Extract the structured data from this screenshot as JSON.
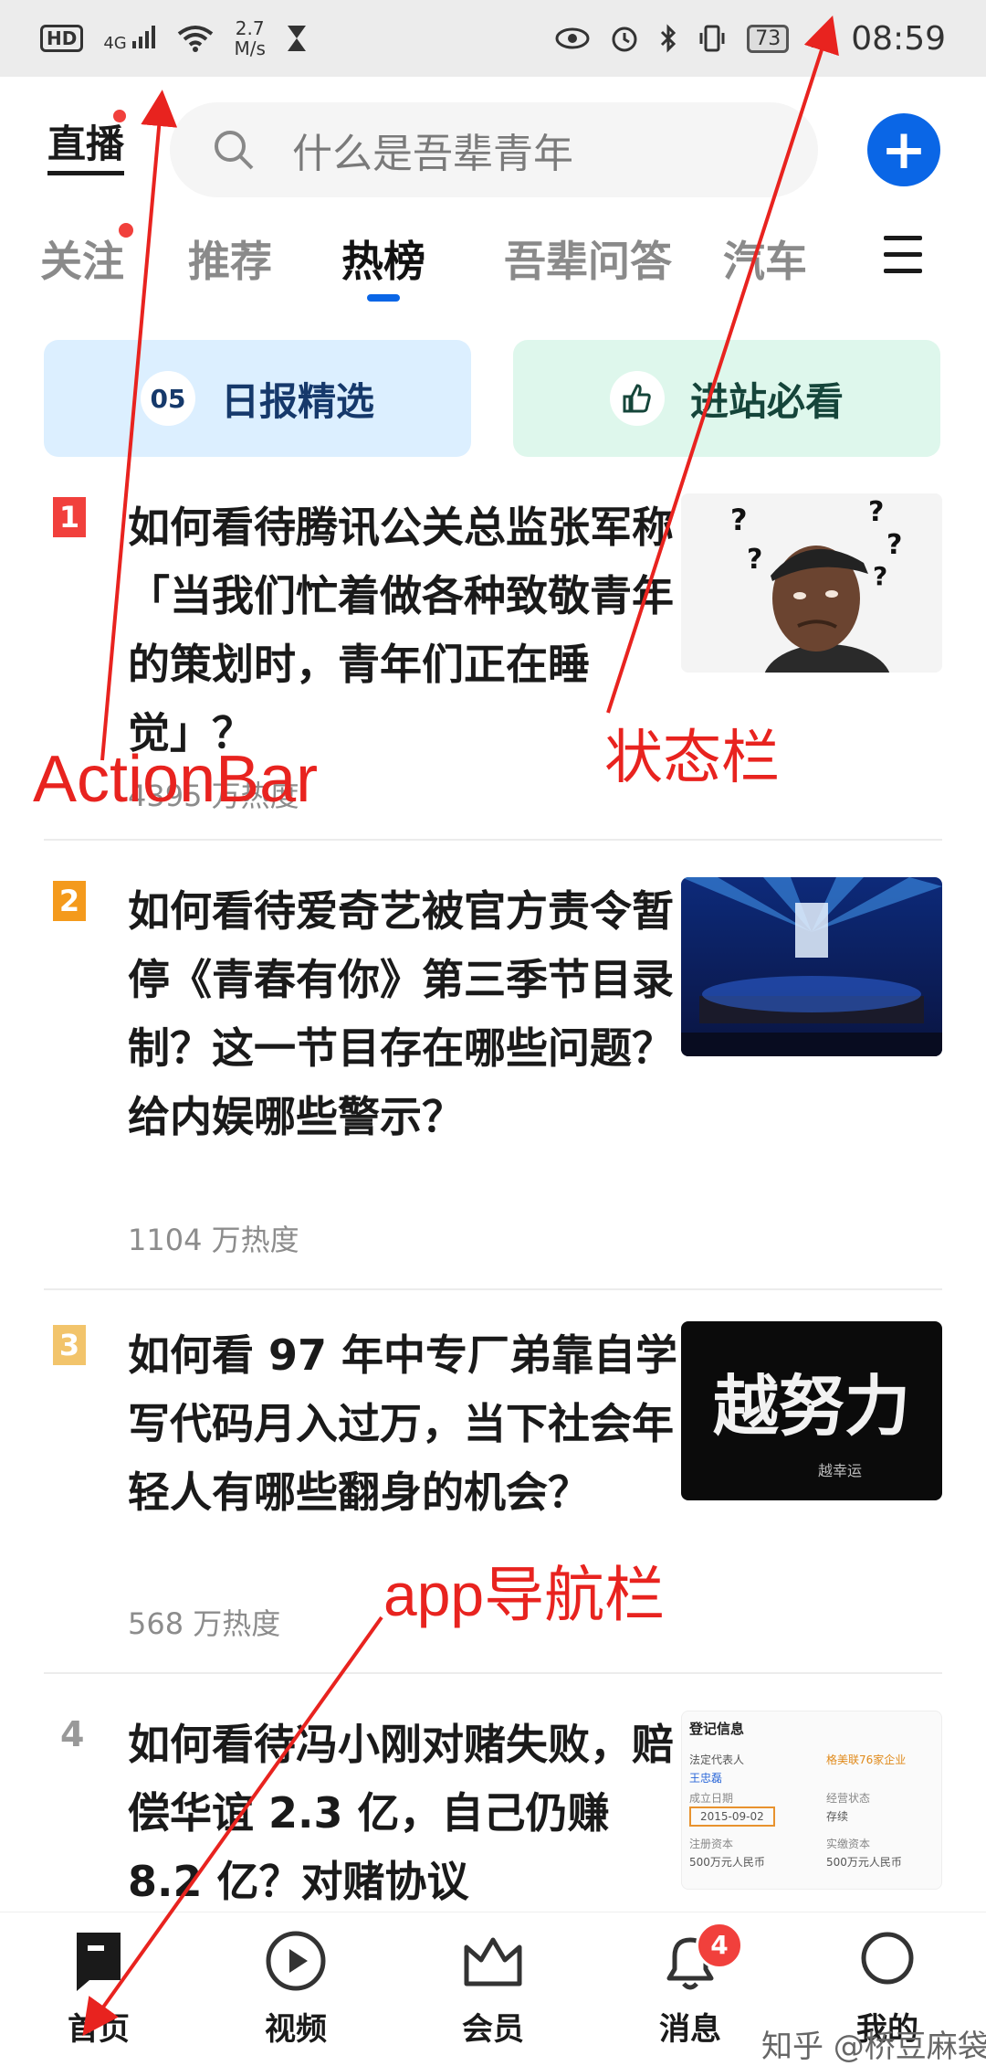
{
  "status_bar": {
    "hd": "HD",
    "network": "4G",
    "speed_value": "2.7",
    "speed_unit": "M/s",
    "battery": "73",
    "time": "08:59"
  },
  "action_bar": {
    "live_label": "直播",
    "search_placeholder": "什么是吾辈青年"
  },
  "tabs": [
    {
      "label": "关注"
    },
    {
      "label": "推荐"
    },
    {
      "label": "热榜",
      "active": true
    },
    {
      "label": "吾辈问答"
    },
    {
      "label": "汽车"
    }
  ],
  "banners": [
    {
      "badge": "05",
      "label": "日报精选"
    },
    {
      "label": "进站必看"
    }
  ],
  "feed": [
    {
      "rank": "1",
      "title": "如何看待腾讯公关总监张军称「当我们忙着做各种致敬青年的策划时，青年们正在睡觉」？",
      "heat": "4395 万热度"
    },
    {
      "rank": "2",
      "title": "如何看待爱奇艺被官方责令暂停《青春有你》第三季节目录制？这一节目存在哪些问题？给内娱哪些警示？",
      "heat": "1104 万热度"
    },
    {
      "rank": "3",
      "title": "如何看 97 年中专厂弟靠自学写代码月入过万，当下社会年轻人有哪些翻身的机会？",
      "heat": "568 万热度",
      "thumb_text": "越努力",
      "thumb_sub": "越幸运"
    },
    {
      "rank": "4",
      "title": "如何看待冯小刚对赌失败，赔偿华谊 2.3 亿，自己仍赚 8.2 亿？对赌协议"
    }
  ],
  "thumb4": {
    "heading": "登记信息",
    "rep_label": "法定代表人",
    "rep_value": "王忠磊",
    "link": "格美联76家企业",
    "date_label": "成立日期",
    "date": "2015-09-02",
    "status_label": "经营状态",
    "status_value": "存续",
    "cap_label": "注册资本",
    "cap_value": "500万元人民币",
    "paid_label": "实缴资本",
    "paid_value": "500万元人民币"
  },
  "bottom_nav": [
    {
      "label": "首页"
    },
    {
      "label": "视频"
    },
    {
      "label": "会员"
    },
    {
      "label": "消息",
      "badge": "4"
    },
    {
      "label": "我的"
    }
  ],
  "watermark": "知乎 @桥豆麻袋",
  "annotations": {
    "actionbar": "ActionBar",
    "statusbar": "状态栏",
    "appnav": "app导航栏"
  },
  "colors": {
    "accent": "#0a66e6",
    "rank1": "#f1403c",
    "rank2": "#f49a1c",
    "rank3": "#f2c46b",
    "annotation": "#e8231f"
  }
}
